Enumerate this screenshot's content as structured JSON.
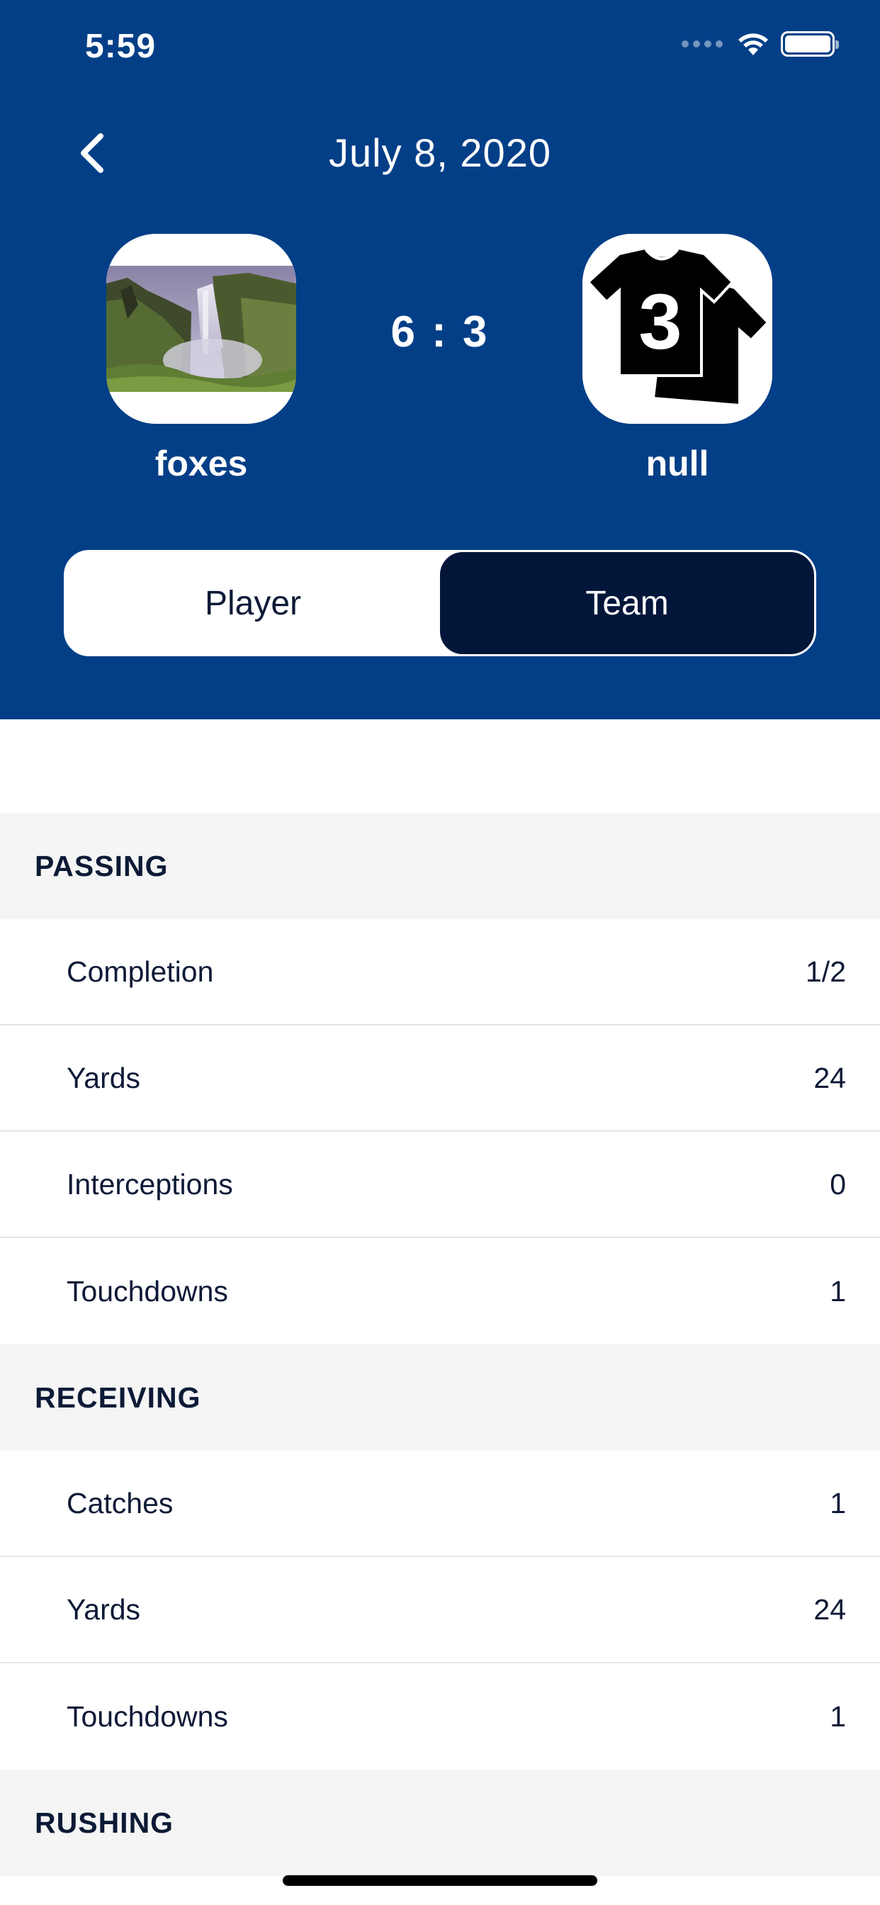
{
  "status_bar": {
    "time": "5:59"
  },
  "header": {
    "title": "July 8, 2020",
    "score": "6 : 3",
    "home_team": {
      "name": "foxes",
      "logo": "waterfall-photo"
    },
    "away_team": {
      "name": "null",
      "logo": "jersey-number-3-icon"
    }
  },
  "segmented_control": {
    "options": [
      "Player",
      "Team"
    ],
    "selected": "Team"
  },
  "sections": [
    {
      "title": "PASSING",
      "rows": [
        {
          "label": "Completion",
          "value": "1/2"
        },
        {
          "label": "Yards",
          "value": "24"
        },
        {
          "label": "Interceptions",
          "value": "0"
        },
        {
          "label": "Touchdowns",
          "value": "1"
        }
      ]
    },
    {
      "title": "RECEIVING",
      "rows": [
        {
          "label": "Catches",
          "value": "1"
        },
        {
          "label": "Yards",
          "value": "24"
        },
        {
          "label": "Touchdowns",
          "value": "1"
        }
      ]
    },
    {
      "title": "RUSHING",
      "rows": []
    }
  ],
  "colors": {
    "header_bg": "#033f87",
    "selected_segment": "#02163a",
    "section_bg": "#f5f5f5",
    "text": "#0d1a36"
  }
}
